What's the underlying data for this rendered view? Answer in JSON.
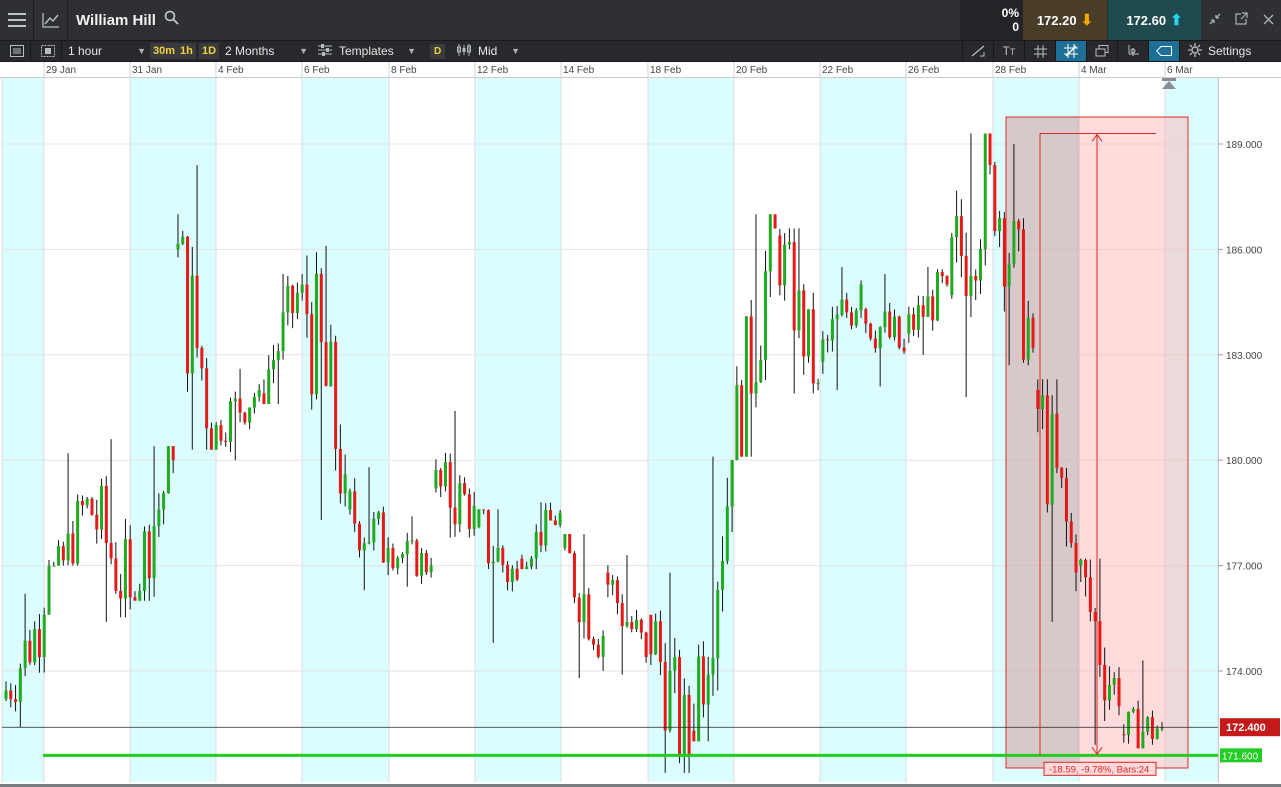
{
  "window": {
    "title": "William Hill",
    "change_pct": "0%",
    "change_val": "0",
    "sell_price": "172.20",
    "buy_price": "172.60"
  },
  "toolbar": {
    "interval": "1 hour",
    "quick_intervals": [
      "30m",
      "1h",
      "1D"
    ],
    "range": "2 Months",
    "templates": "Templates",
    "d_chip": "D",
    "price_type": "Mid",
    "settings": "Settings"
  },
  "chart_data": {
    "type": "candlestick",
    "x_tick_labels": [
      "29 Jan",
      "31 Jan",
      "4 Feb",
      "6 Feb",
      "8 Feb",
      "12 Feb",
      "14 Feb",
      "18 Feb",
      "20 Feb",
      "22 Feb",
      "26 Feb",
      "28 Feb",
      "4 Mar",
      "6 Mar"
    ],
    "y_tick_labels": [
      "189.000",
      "186.000",
      "183.000",
      "180.000",
      "177.000",
      "174.000"
    ],
    "y_ticks": [
      189,
      186,
      183,
      180,
      177,
      174
    ],
    "ylim": [
      170.2,
      190.3
    ],
    "current_price_label": "172.400",
    "current_price": 172.4,
    "support_label": "171.600",
    "support_level": 171.6,
    "measure_label": "-18.59, -9.78%, Bars:24",
    "measure_from": 189.3,
    "measure_to": 171.6,
    "candles_hourly_approx": [
      {
        "date": "29 Jan",
        "open": 173.2,
        "close": 175.6,
        "high": 176.2,
        "low": 172.4
      },
      {
        "date": "30 Jan",
        "open": 175.6,
        "close": 178.9,
        "high": 180.2,
        "low": 177.0
      },
      {
        "date": "31 Jan",
        "open": 178.9,
        "close": 176.1,
        "high": 180.6,
        "low": 175.4
      },
      {
        "date": "1 Feb",
        "open": 176.1,
        "close": 180.0,
        "high": 180.4,
        "low": 176.0
      },
      {
        "date": "4 Feb",
        "open": 186.0,
        "close": 181.0,
        "high": 188.4,
        "low": 180.3
      },
      {
        "date": "5 Feb",
        "open": 181.0,
        "close": 182.0,
        "high": 182.6,
        "low": 180.0
      },
      {
        "date": "6 Feb",
        "open": 181.9,
        "close": 185.0,
        "high": 185.3,
        "low": 181.6
      },
      {
        "date": "7 Feb",
        "open": 185.0,
        "close": 179.6,
        "high": 186.1,
        "low": 178.3
      },
      {
        "date": "8 Feb",
        "open": 178.6,
        "close": 177.5,
        "high": 179.8,
        "low": 176.3
      },
      {
        "date": "11 Feb",
        "open": 177.5,
        "close": 177.0,
        "high": 178.4,
        "low": 176.4
      },
      {
        "date": "12 Feb",
        "open": 179.2,
        "close": 178.7,
        "high": 181.4,
        "low": 177.8
      },
      {
        "date": "13 Feb",
        "open": 178.1,
        "close": 176.6,
        "high": 178.6,
        "low": 174.8
      },
      {
        "date": "14 Feb",
        "open": 177.2,
        "close": 178.5,
        "high": 178.8,
        "low": 176.9
      },
      {
        "date": "15 Feb",
        "open": 177.5,
        "close": 175.0,
        "high": 177.9,
        "low": 173.8
      },
      {
        "date": "18 Feb",
        "open": 176.8,
        "close": 174.4,
        "high": 177.3,
        "low": 173.9
      },
      {
        "date": "19 Feb",
        "open": 175.6,
        "close": 171.6,
        "high": 176.8,
        "low": 171.1
      },
      {
        "date": "20 Feb",
        "open": 172.3,
        "close": 180.0,
        "high": 180.1,
        "low": 172.0
      },
      {
        "date": "21 Feb",
        "open": 180.0,
        "close": 186.6,
        "high": 187.0,
        "low": 180.1
      },
      {
        "date": "22 Feb",
        "open": 186.4,
        "close": 182.2,
        "high": 186.6,
        "low": 181.9
      },
      {
        "date": "25 Feb",
        "open": 182.8,
        "close": 185.0,
        "high": 185.5,
        "low": 182.0
      },
      {
        "date": "26 Feb",
        "open": 184.3,
        "close": 183.1,
        "high": 185.3,
        "low": 182.1
      },
      {
        "date": "27 Feb",
        "open": 183.6,
        "close": 185.0,
        "high": 185.5,
        "low": 183.0
      },
      {
        "date": "28 Feb",
        "open": 184.7,
        "close": 188.4,
        "high": 189.3,
        "low": 181.8
      },
      {
        "date": "1 Mar",
        "open": 188.4,
        "close": 183.2,
        "high": 189.0,
        "low": 182.7
      },
      {
        "date": "4 Mar",
        "open": 182.0,
        "close": 176.8,
        "high": 182.3,
        "low": 175.4
      },
      {
        "date": "5 Mar",
        "open": 177.0,
        "close": 173.0,
        "high": 177.2,
        "low": 171.9
      },
      {
        "date": "6 Mar",
        "open": 172.2,
        "close": 172.4,
        "high": 174.3,
        "low": 171.8
      }
    ]
  }
}
